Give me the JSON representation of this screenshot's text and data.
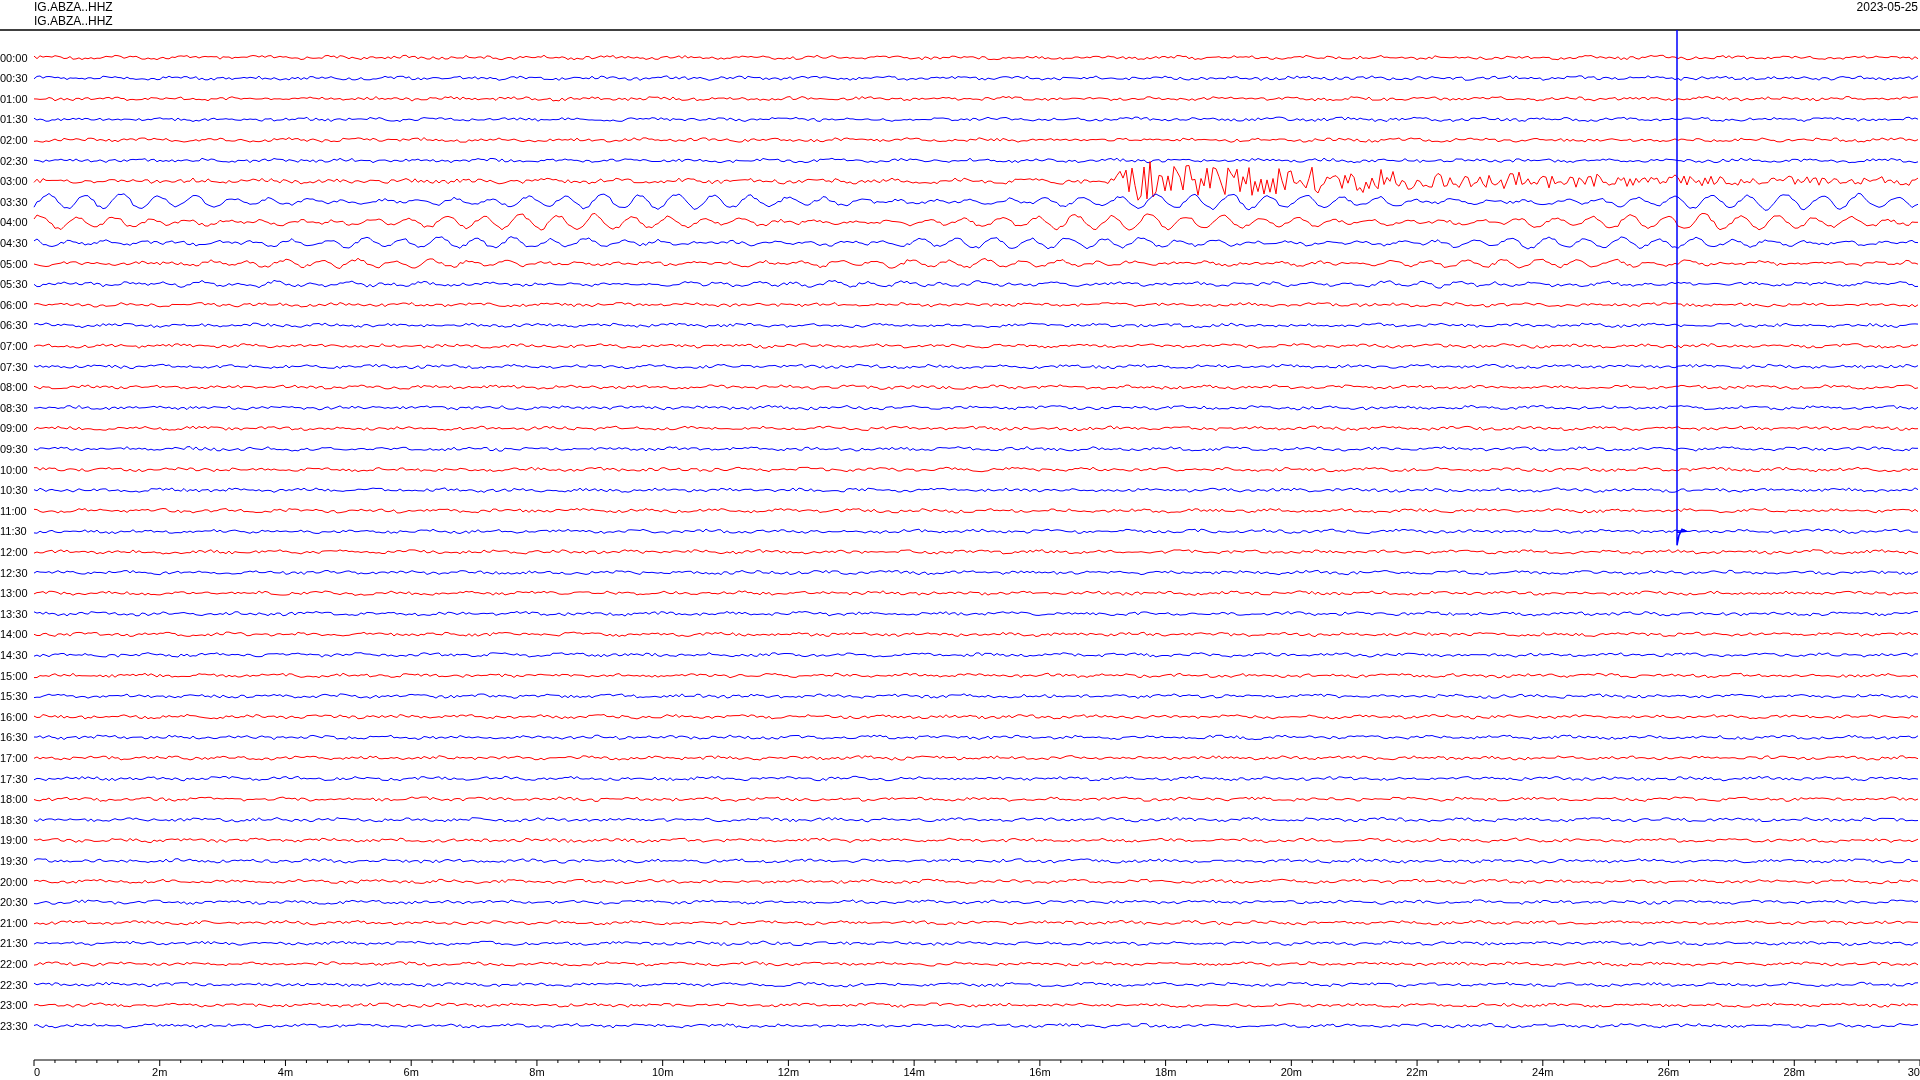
{
  "header": {
    "stations": [
      "IG.ABZA..HHZ",
      "IG.ABZA..HHZ"
    ],
    "date": "2023-05-25"
  },
  "rows": [
    {
      "time": "00:00",
      "color": "#ff0000"
    },
    {
      "time": "00:30",
      "color": "#0000ff"
    },
    {
      "time": "01:00",
      "color": "#ff0000"
    },
    {
      "time": "01:30",
      "color": "#0000ff"
    },
    {
      "time": "02:00",
      "color": "#ff0000"
    },
    {
      "time": "02:30",
      "color": "#0000ff"
    },
    {
      "time": "03:00",
      "color": "#ff0000"
    },
    {
      "time": "03:30",
      "color": "#0000ff"
    },
    {
      "time": "04:00",
      "color": "#ff0000"
    },
    {
      "time": "04:30",
      "color": "#0000ff"
    },
    {
      "time": "05:00",
      "color": "#ff0000"
    },
    {
      "time": "05:30",
      "color": "#0000ff"
    },
    {
      "time": "06:00",
      "color": "#ff0000"
    },
    {
      "time": "06:30",
      "color": "#0000ff"
    },
    {
      "time": "07:00",
      "color": "#ff0000"
    },
    {
      "time": "07:30",
      "color": "#0000ff"
    },
    {
      "time": "08:00",
      "color": "#ff0000"
    },
    {
      "time": "08:30",
      "color": "#0000ff"
    },
    {
      "time": "09:00",
      "color": "#ff0000"
    },
    {
      "time": "09:30",
      "color": "#0000ff"
    },
    {
      "time": "10:00",
      "color": "#ff0000"
    },
    {
      "time": "10:30",
      "color": "#0000ff"
    },
    {
      "time": "11:00",
      "color": "#ff0000"
    },
    {
      "time": "11:30",
      "color": "#0000ff"
    },
    {
      "time": "12:00",
      "color": "#ff0000"
    },
    {
      "time": "12:30",
      "color": "#0000ff"
    },
    {
      "time": "13:00",
      "color": "#ff0000"
    },
    {
      "time": "13:30",
      "color": "#0000ff"
    },
    {
      "time": "14:00",
      "color": "#ff0000"
    },
    {
      "time": "14:30",
      "color": "#0000ff"
    },
    {
      "time": "15:00",
      "color": "#ff0000"
    },
    {
      "time": "15:30",
      "color": "#0000ff"
    },
    {
      "time": "16:00",
      "color": "#ff0000"
    },
    {
      "time": "16:30",
      "color": "#0000ff"
    },
    {
      "time": "17:00",
      "color": "#ff0000"
    },
    {
      "time": "17:30",
      "color": "#0000ff"
    },
    {
      "time": "18:00",
      "color": "#ff0000"
    },
    {
      "time": "18:30",
      "color": "#0000ff"
    },
    {
      "time": "19:00",
      "color": "#ff0000"
    },
    {
      "time": "19:30",
      "color": "#0000ff"
    },
    {
      "time": "20:00",
      "color": "#ff0000"
    },
    {
      "time": "20:30",
      "color": "#0000ff"
    },
    {
      "time": "21:00",
      "color": "#ff0000"
    },
    {
      "time": "21:30",
      "color": "#0000ff"
    },
    {
      "time": "22:00",
      "color": "#ff0000"
    },
    {
      "time": "22:30",
      "color": "#0000ff"
    },
    {
      "time": "23:00",
      "color": "#ff0000"
    },
    {
      "time": "23:30",
      "color": "#0000ff"
    }
  ],
  "axis": {
    "ticks": [
      "0",
      "2m",
      "4m",
      "6m",
      "8m",
      "10m",
      "12m",
      "14m",
      "16m",
      "18m",
      "20m",
      "22m",
      "24m",
      "26m",
      "28m",
      "30"
    ]
  }
}
